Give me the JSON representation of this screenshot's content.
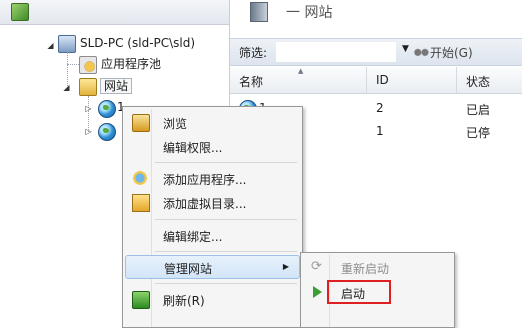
{
  "tree": {
    "server": "SLD-PC (sld-PC\\sld)",
    "app_pools": "应用程序池",
    "sites": "网站",
    "site_1_partial": "1"
  },
  "content": {
    "header_partial": "一 网站",
    "filter_label": "筛选:",
    "filter_value": "",
    "start_filter": "开始(G)",
    "columns": {
      "name": "名称",
      "id": "ID",
      "status": "状态"
    },
    "rows": [
      {
        "name": "1",
        "id": "2",
        "status": "已启"
      },
      {
        "name": "",
        "id": "1",
        "status": "已停"
      }
    ]
  },
  "context_menu": {
    "items": [
      {
        "label": "浏览",
        "icon": "browse-icon"
      },
      {
        "label": "编辑权限...",
        "icon": ""
      },
      {
        "label": "添加应用程序...",
        "icon": "add-application-icon"
      },
      {
        "label": "添加虚拟目录...",
        "icon": "add-virtual-directory-icon"
      },
      {
        "label": "编辑绑定...",
        "icon": ""
      },
      {
        "label": "管理网站",
        "icon": ""
      },
      {
        "label": "刷新(R)",
        "icon": "refresh-icon"
      }
    ]
  },
  "submenu": {
    "items": [
      {
        "label": "重新启动",
        "disabled": true,
        "icon": "restart-icon"
      },
      {
        "label": "启动",
        "disabled": false,
        "icon": "play-icon"
      }
    ]
  },
  "colors": {
    "highlight_box": "#e02020",
    "menu_hover": "#d2e5f7"
  }
}
